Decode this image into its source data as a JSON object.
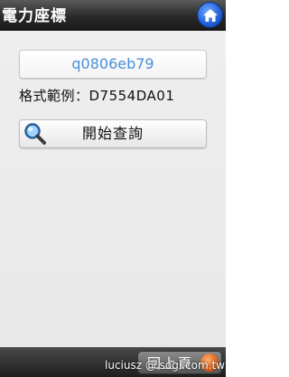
{
  "header": {
    "title": "電力座標",
    "home_icon": "home-icon"
  },
  "main": {
    "code_value": "q0806eb79",
    "format_example": "格式範例：D7554DA01",
    "query_button_label": "開始查詢",
    "query_icon": "magnifier-icon"
  },
  "footer": {
    "back_button_label": "回上頁"
  },
  "watermark": "luciusz @ sogi.com.tw",
  "colors": {
    "code_text": "#4a90d9",
    "title_bar": "#2a2a2a",
    "home_button": "#1f5fd6"
  }
}
